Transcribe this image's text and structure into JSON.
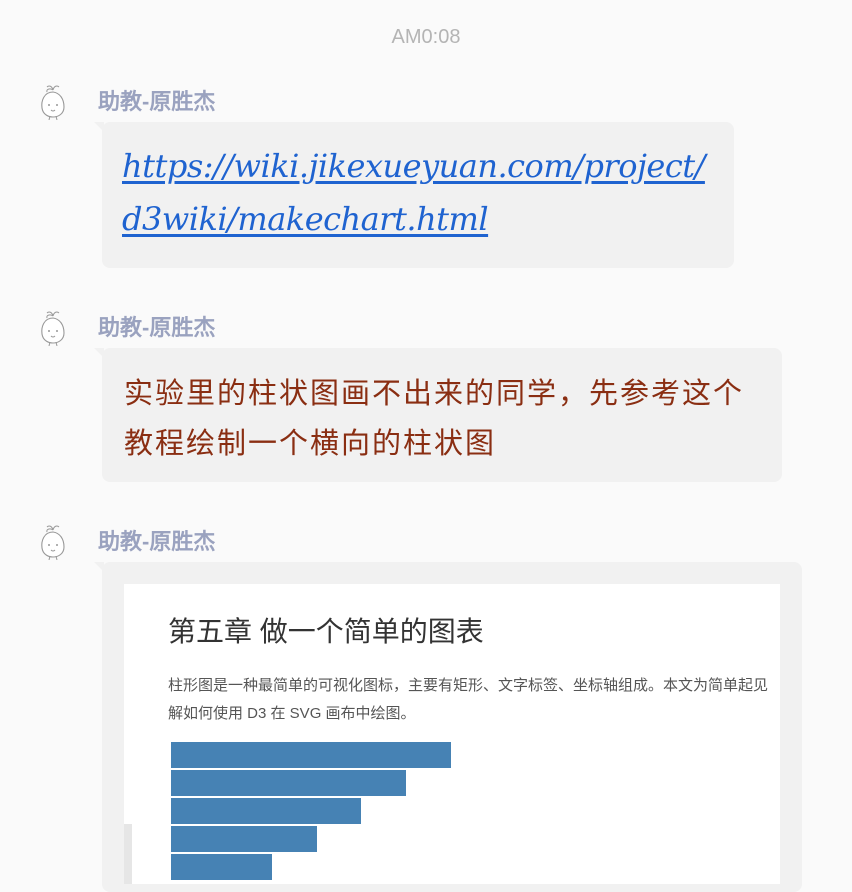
{
  "timestamp": "AM0:08",
  "messages": [
    {
      "sender": "助教-原胜杰",
      "type": "link",
      "text": "https://wiki.jikexueyuan.com/project/d3wiki/makechart.html"
    },
    {
      "sender": "助教-原胜杰",
      "type": "text",
      "text": "实验里的柱状图画不出来的同学，先参考这个教程绘制一个横向的柱状图"
    },
    {
      "sender": "助教-原胜杰",
      "type": "image",
      "image": {
        "title": "第五章 做一个简单的图表",
        "paragraph_line1": "柱形图是一种最简单的可视化图标，主要有矩形、文字标签、坐标轴组成。本文为简单起见",
        "paragraph_line2": "解如何使用 D3 在 SVG 画布中绘图。",
        "bar_color": "#4682b4",
        "bar_values": [
          250,
          210,
          170,
          130,
          90
        ]
      }
    }
  ],
  "colors": {
    "sender": "#9aa2bf",
    "link": "#1f63d0",
    "message_text": "#8a2e12",
    "bubble": "#f1f1f1"
  },
  "icons": [
    "cartoon-avatar-icon"
  ]
}
